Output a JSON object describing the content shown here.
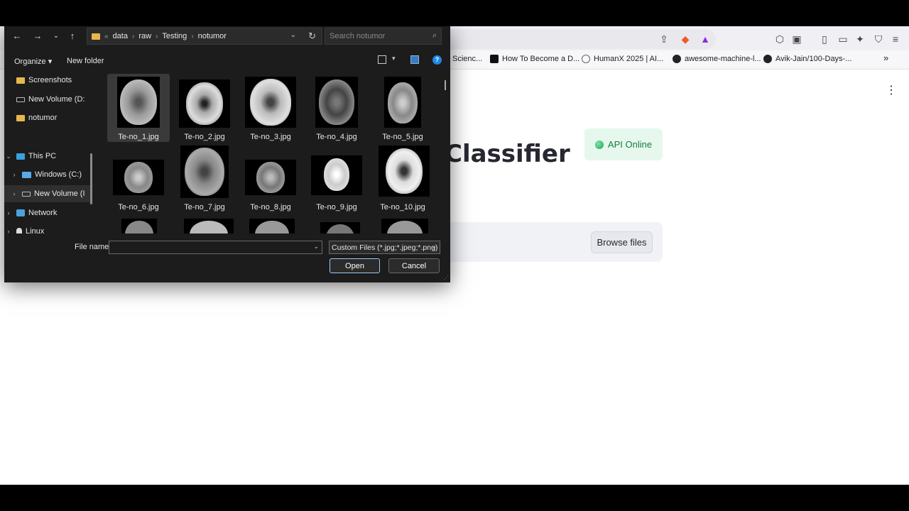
{
  "browser": {
    "bookmarks": [
      {
        "label": "Scienc...",
        "icon": "globe-icon"
      },
      {
        "label": "How To Become a D...",
        "icon": "medium-icon"
      },
      {
        "label": "HumanX 2025 | AI...",
        "icon": "globe-icon"
      },
      {
        "label": "awesome-machine-l...",
        "icon": "github-icon"
      },
      {
        "label": "Avik-Jain/100-Days-...",
        "icon": "github-icon"
      }
    ],
    "more_bookmarks": "»"
  },
  "app": {
    "title": "Classifier",
    "api_status": "API Online",
    "browse_button": "Browse files"
  },
  "dialog": {
    "path": [
      "data",
      "raw",
      "Testing",
      "notumor"
    ],
    "path_prefix": "«",
    "search_placeholder": "Search notumor",
    "organize": "Organize ▾",
    "new_folder": "New folder",
    "nav": [
      {
        "label": "Screenshots",
        "icon": "folder-icon"
      },
      {
        "label": "New Volume (D:",
        "icon": "drive-icon"
      },
      {
        "label": "notumor",
        "icon": "folder-icon"
      },
      {
        "label": "This PC",
        "icon": "pc-icon"
      },
      {
        "label": "Windows (C:)",
        "icon": "windows-drive-icon"
      },
      {
        "label": "New Volume (I",
        "icon": "drive-icon"
      },
      {
        "label": "Network",
        "icon": "network-icon"
      },
      {
        "label": "Linux",
        "icon": "linux-icon"
      }
    ],
    "files": [
      "Te-no_1.jpg",
      "Te-no_2.jpg",
      "Te-no_3.jpg",
      "Te-no_4.jpg",
      "Te-no_5.jpg",
      "Te-no_6.jpg",
      "Te-no_7.jpg",
      "Te-no_8.jpg",
      "Te-no_9.jpg",
      "Te-no_10.jpg"
    ],
    "selected_file": "Te-no_1.jpg",
    "file_name_label": "File name:",
    "file_name_value": "",
    "file_type": "Custom Files (*.jpg;*.jpeg;*.png)",
    "open": "Open",
    "cancel": "Cancel"
  }
}
